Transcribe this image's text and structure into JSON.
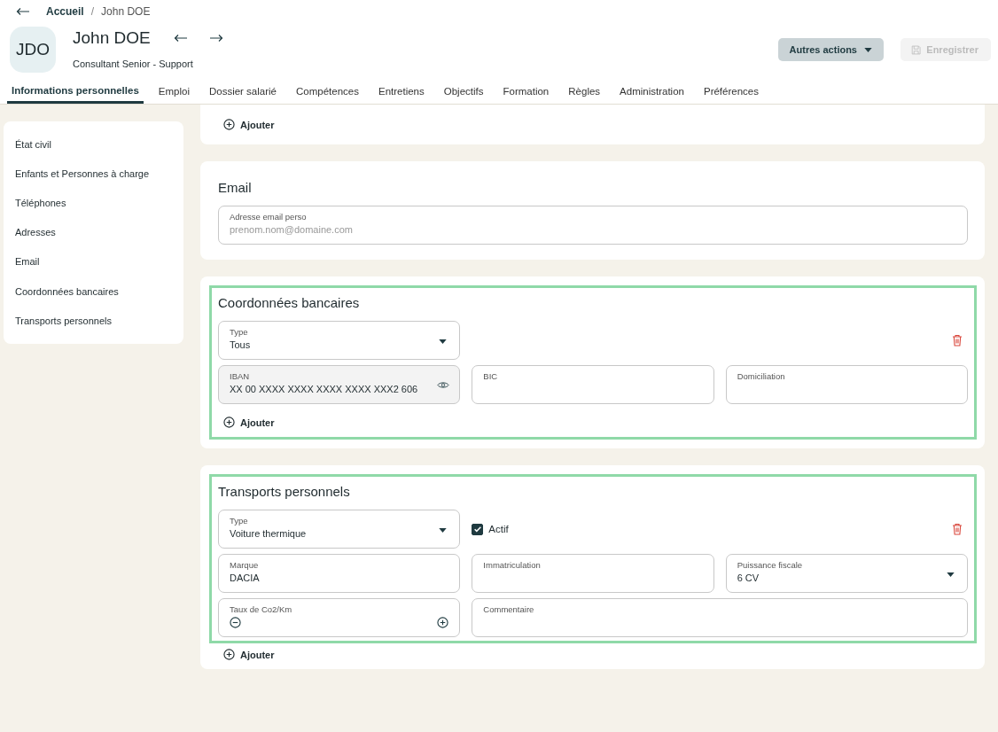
{
  "breadcrumb_separator": "/",
  "breadcrumb": [
    {
      "label": "Accueil",
      "selected": false
    },
    {
      "label": "John DOE",
      "selected": true
    }
  ],
  "header": {
    "avatar": "JDO",
    "name": "John DOE",
    "subtitle": "Consultant Senior - Support"
  },
  "actions": [
    {
      "label": "Autres actions",
      "kind": "menu",
      "disabled": false
    },
    {
      "label": "Enregistrer",
      "kind": "save",
      "disabled": true
    }
  ],
  "tabs": [
    {
      "label": "Informations personnelles",
      "selected": true
    },
    {
      "label": "Emploi",
      "selected": false
    },
    {
      "label": "Dossier salarié",
      "selected": false
    },
    {
      "label": "Compétences",
      "selected": false
    },
    {
      "label": "Entretiens",
      "selected": false
    },
    {
      "label": "Objectifs",
      "selected": false
    },
    {
      "label": "Formation",
      "selected": false
    },
    {
      "label": "Règles",
      "selected": false
    },
    {
      "label": "Administration",
      "selected": false
    },
    {
      "label": "Préférences",
      "selected": false
    }
  ],
  "sidebar": {
    "items": [
      "État civil",
      "Enfants et Personnes à charge",
      "Téléphones",
      "Adresses",
      "Email",
      "Coordonnées bancaires",
      "Transports personnels"
    ]
  },
  "sections": [
    {
      "highlighted": false,
      "add_label": "Ajouter"
    },
    {
      "title": "Email",
      "highlighted": false,
      "rows": [
        [
          {
            "kind": "text",
            "label": "Adresse email perso",
            "placeholder": "prenom.nom@domaine.com",
            "wide": true
          }
        ]
      ]
    },
    {
      "title": "Coordonnées bancaires",
      "highlighted": true,
      "removable": true,
      "rows": [
        [
          {
            "kind": "select",
            "label": "Type",
            "value": "Tous"
          }
        ],
        [
          {
            "kind": "masked",
            "label": "IBAN",
            "value": "XX 00 XXXX XXXX XXXX XXXX XXX2 606"
          },
          {
            "kind": "text",
            "label": "BIC"
          },
          {
            "kind": "text",
            "label": "Domiciliation"
          }
        ]
      ],
      "add_label": "Ajouter"
    },
    {
      "title": "Transports personnels",
      "highlighted": true,
      "removable": true,
      "rows": [
        [
          {
            "kind": "select",
            "label": "Type",
            "value": "Voiture thermique"
          },
          {
            "kind": "checkbox",
            "label": "Actif",
            "checked": true
          }
        ],
        [
          {
            "kind": "text",
            "label": "Marque",
            "value": "DACIA"
          },
          {
            "kind": "text",
            "label": "Immatriculation"
          },
          {
            "kind": "select",
            "label": "Puissance fiscale",
            "value": "6 CV"
          }
        ],
        [
          {
            "kind": "stepper",
            "label": "Taux de Co2/Km"
          },
          {
            "kind": "comment",
            "label": "Commentaire"
          }
        ]
      ],
      "add_label": "Ajouter",
      "add_outside": true
    }
  ]
}
